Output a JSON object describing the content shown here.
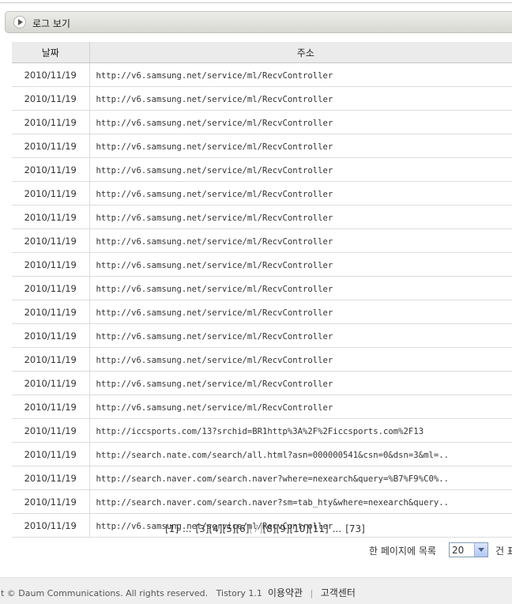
{
  "header": {
    "title": "로그 보기"
  },
  "table": {
    "columns": [
      "날짜",
      "주소"
    ],
    "rows": [
      {
        "date": "2010/11/19",
        "url": "http://v6.samsung.net/service/ml/RecvController"
      },
      {
        "date": "2010/11/19",
        "url": "http://v6.samsung.net/service/ml/RecvController"
      },
      {
        "date": "2010/11/19",
        "url": "http://v6.samsung.net/service/ml/RecvController"
      },
      {
        "date": "2010/11/19",
        "url": "http://v6.samsung.net/service/ml/RecvController"
      },
      {
        "date": "2010/11/19",
        "url": "http://v6.samsung.net/service/ml/RecvController"
      },
      {
        "date": "2010/11/19",
        "url": "http://v6.samsung.net/service/ml/RecvController"
      },
      {
        "date": "2010/11/19",
        "url": "http://v6.samsung.net/service/ml/RecvController"
      },
      {
        "date": "2010/11/19",
        "url": "http://v6.samsung.net/service/ml/RecvController"
      },
      {
        "date": "2010/11/19",
        "url": "http://v6.samsung.net/service/ml/RecvController"
      },
      {
        "date": "2010/11/19",
        "url": "http://v6.samsung.net/service/ml/RecvController"
      },
      {
        "date": "2010/11/19",
        "url": "http://v6.samsung.net/service/ml/RecvController"
      },
      {
        "date": "2010/11/19",
        "url": "http://v6.samsung.net/service/ml/RecvController"
      },
      {
        "date": "2010/11/19",
        "url": "http://v6.samsung.net/service/ml/RecvController"
      },
      {
        "date": "2010/11/19",
        "url": "http://v6.samsung.net/service/ml/RecvController"
      },
      {
        "date": "2010/11/19",
        "url": "http://v6.samsung.net/service/ml/RecvController"
      },
      {
        "date": "2010/11/19",
        "url": "http://iccsports.com/13?srchid=BR1http%3A%2F%2Ficcsports.com%2F13"
      },
      {
        "date": "2010/11/19",
        "url": "http://search.nate.com/search/all.html?asn=000000541&csn=0&dsn=3&ml=.."
      },
      {
        "date": "2010/11/19",
        "url": "http://search.naver.com/search.naver?where=nexearch&query=%B7%F9%C0%.."
      },
      {
        "date": "2010/11/19",
        "url": "http://search.naver.com/search.naver?sm=tab_hty&where=nexearch&query.."
      },
      {
        "date": "2010/11/19",
        "url": "http://v6.samsung.net/service/ml/RecvController"
      }
    ]
  },
  "pagination": {
    "pages": [
      {
        "label": "[1]",
        "current": false
      },
      {
        "label": "...",
        "current": false
      },
      {
        "label": "[3]",
        "current": false
      },
      {
        "label": "[4]",
        "current": false
      },
      {
        "label": "[5]",
        "current": false
      },
      {
        "label": "[6]",
        "current": false
      },
      {
        "label": "[7]",
        "current": true
      },
      {
        "label": "[8]",
        "current": false
      },
      {
        "label": "[9]",
        "current": false
      },
      {
        "label": "[10]",
        "current": false
      },
      {
        "label": "[11]",
        "current": false
      },
      {
        "label": "...",
        "current": false
      },
      {
        "label": "[73]",
        "current": false
      }
    ]
  },
  "per_page": {
    "label": "한 페이지에 목록",
    "value": "20",
    "suffix": "건 표"
  },
  "footer": {
    "copyright": "nt © Daum Communications. All rights reserved.",
    "version": "Tistory 1.1",
    "terms": "이용약관",
    "separator": "|",
    "support": "고객센터"
  }
}
